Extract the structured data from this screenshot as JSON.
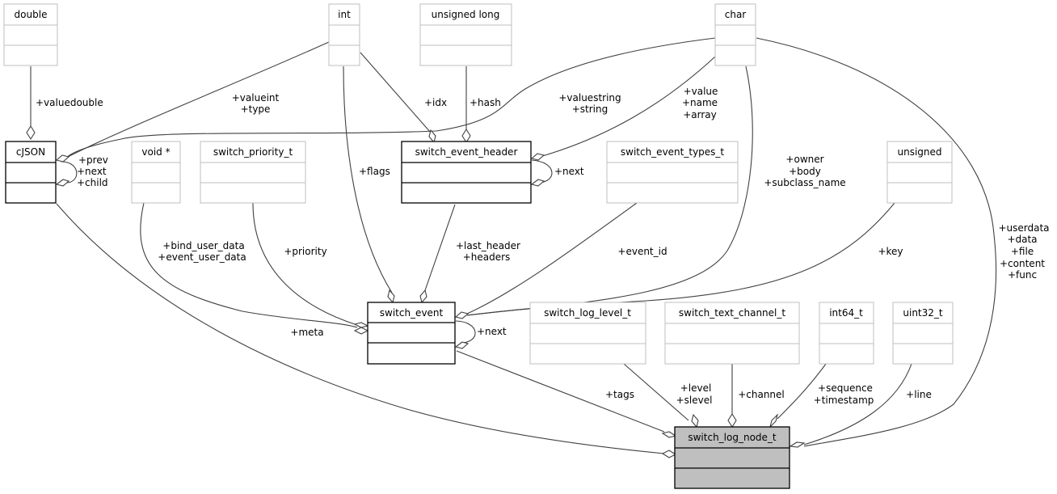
{
  "diagram": {
    "type": "collaboration-graph",
    "nodes": {
      "double": {
        "label": "double",
        "style": "external"
      },
      "int": {
        "label": "int",
        "style": "external"
      },
      "unsigned_long": {
        "label": "unsigned long",
        "style": "external"
      },
      "char": {
        "label": "char",
        "style": "external"
      },
      "cjson": {
        "label": "cJSON",
        "style": "documented"
      },
      "void_ptr": {
        "label": "void *",
        "style": "external"
      },
      "switch_priority_t": {
        "label": "switch_priority_t",
        "style": "external"
      },
      "switch_event_header": {
        "label": "switch_event_header",
        "style": "documented"
      },
      "switch_event_types_t": {
        "label": "switch_event_types_t",
        "style": "external"
      },
      "unsigned": {
        "label": "unsigned",
        "style": "external"
      },
      "switch_event": {
        "label": "switch_event",
        "style": "documented"
      },
      "switch_log_level_t": {
        "label": "switch_log_level_t",
        "style": "external"
      },
      "switch_text_channel_t": {
        "label": "switch_text_channel_t",
        "style": "external"
      },
      "int64_t": {
        "label": "int64_t",
        "style": "external"
      },
      "uint32_t": {
        "label": "uint32_t",
        "style": "external"
      },
      "switch_log_node_t": {
        "label": "switch_log_node_t",
        "style": "focus"
      }
    },
    "edges": {
      "valuedouble": {
        "from": "double",
        "to": "cJSON",
        "labels": [
          "+valuedouble"
        ]
      },
      "valueint": {
        "from": "int",
        "to": "cJSON",
        "labels": [
          "+valueint",
          "+type"
        ]
      },
      "valuestring": {
        "from": "char",
        "to": "cJSON",
        "labels": [
          "+valuestring",
          "+string"
        ]
      },
      "cjson_self": {
        "from": "cJSON",
        "to": "cJSON",
        "labels": [
          "+prev",
          "+next",
          "+child"
        ]
      },
      "idx": {
        "from": "int",
        "to": "switch_event_header",
        "labels": [
          "+idx"
        ]
      },
      "hash": {
        "from": "unsigned long",
        "to": "switch_event_header",
        "labels": [
          "+hash"
        ]
      },
      "header_char": {
        "from": "char",
        "to": "switch_event_header",
        "labels": [
          "+value",
          "+name",
          "+array"
        ]
      },
      "header_self": {
        "from": "switch_event_header",
        "to": "switch_event_header",
        "labels": [
          "+next"
        ]
      },
      "flags": {
        "from": "int",
        "to": "switch_event",
        "labels": [
          "+flags"
        ]
      },
      "user_data": {
        "from": "void *",
        "to": "switch_event",
        "labels": [
          "+bind_user_data",
          "+event_user_data"
        ]
      },
      "priority": {
        "from": "switch_priority_t",
        "to": "switch_event",
        "labels": [
          "+priority"
        ]
      },
      "headers": {
        "from": "switch_event_header",
        "to": "switch_event",
        "labels": [
          "+last_header",
          "+headers"
        ]
      },
      "event_id": {
        "from": "switch_event_types_t",
        "to": "switch_event",
        "labels": [
          "+event_id"
        ]
      },
      "event_char": {
        "from": "char",
        "to": "switch_event",
        "labels": [
          "+owner",
          "+body",
          "+subclass_name"
        ]
      },
      "key": {
        "from": "unsigned",
        "to": "switch_event",
        "labels": [
          "+key"
        ]
      },
      "event_self": {
        "from": "switch_event",
        "to": "switch_event",
        "labels": [
          "+next"
        ]
      },
      "meta": {
        "from": "cJSON",
        "to": "switch_log_node_t",
        "labels": [
          "+meta"
        ]
      },
      "tags": {
        "from": "switch_event",
        "to": "switch_log_node_t",
        "labels": [
          "+tags"
        ]
      },
      "level": {
        "from": "switch_log_level_t",
        "to": "switch_log_node_t",
        "labels": [
          "+level",
          "+slevel"
        ]
      },
      "channel": {
        "from": "switch_text_channel_t",
        "to": "switch_log_node_t",
        "labels": [
          "+channel"
        ]
      },
      "sequence": {
        "from": "int64_t",
        "to": "switch_log_node_t",
        "labels": [
          "+sequence",
          "+timestamp"
        ]
      },
      "line": {
        "from": "uint32_t",
        "to": "switch_log_node_t",
        "labels": [
          "+line"
        ]
      },
      "userdata": {
        "from": "char",
        "to": "switch_log_node_t",
        "labels": [
          "+userdata",
          "+data",
          "+file",
          "+content",
          "+func"
        ]
      }
    },
    "colors": {
      "external_border": "#bfbfbf",
      "documented_border": "#000000",
      "focus_fill": "#bfbfbf",
      "edge": "#404040"
    }
  }
}
